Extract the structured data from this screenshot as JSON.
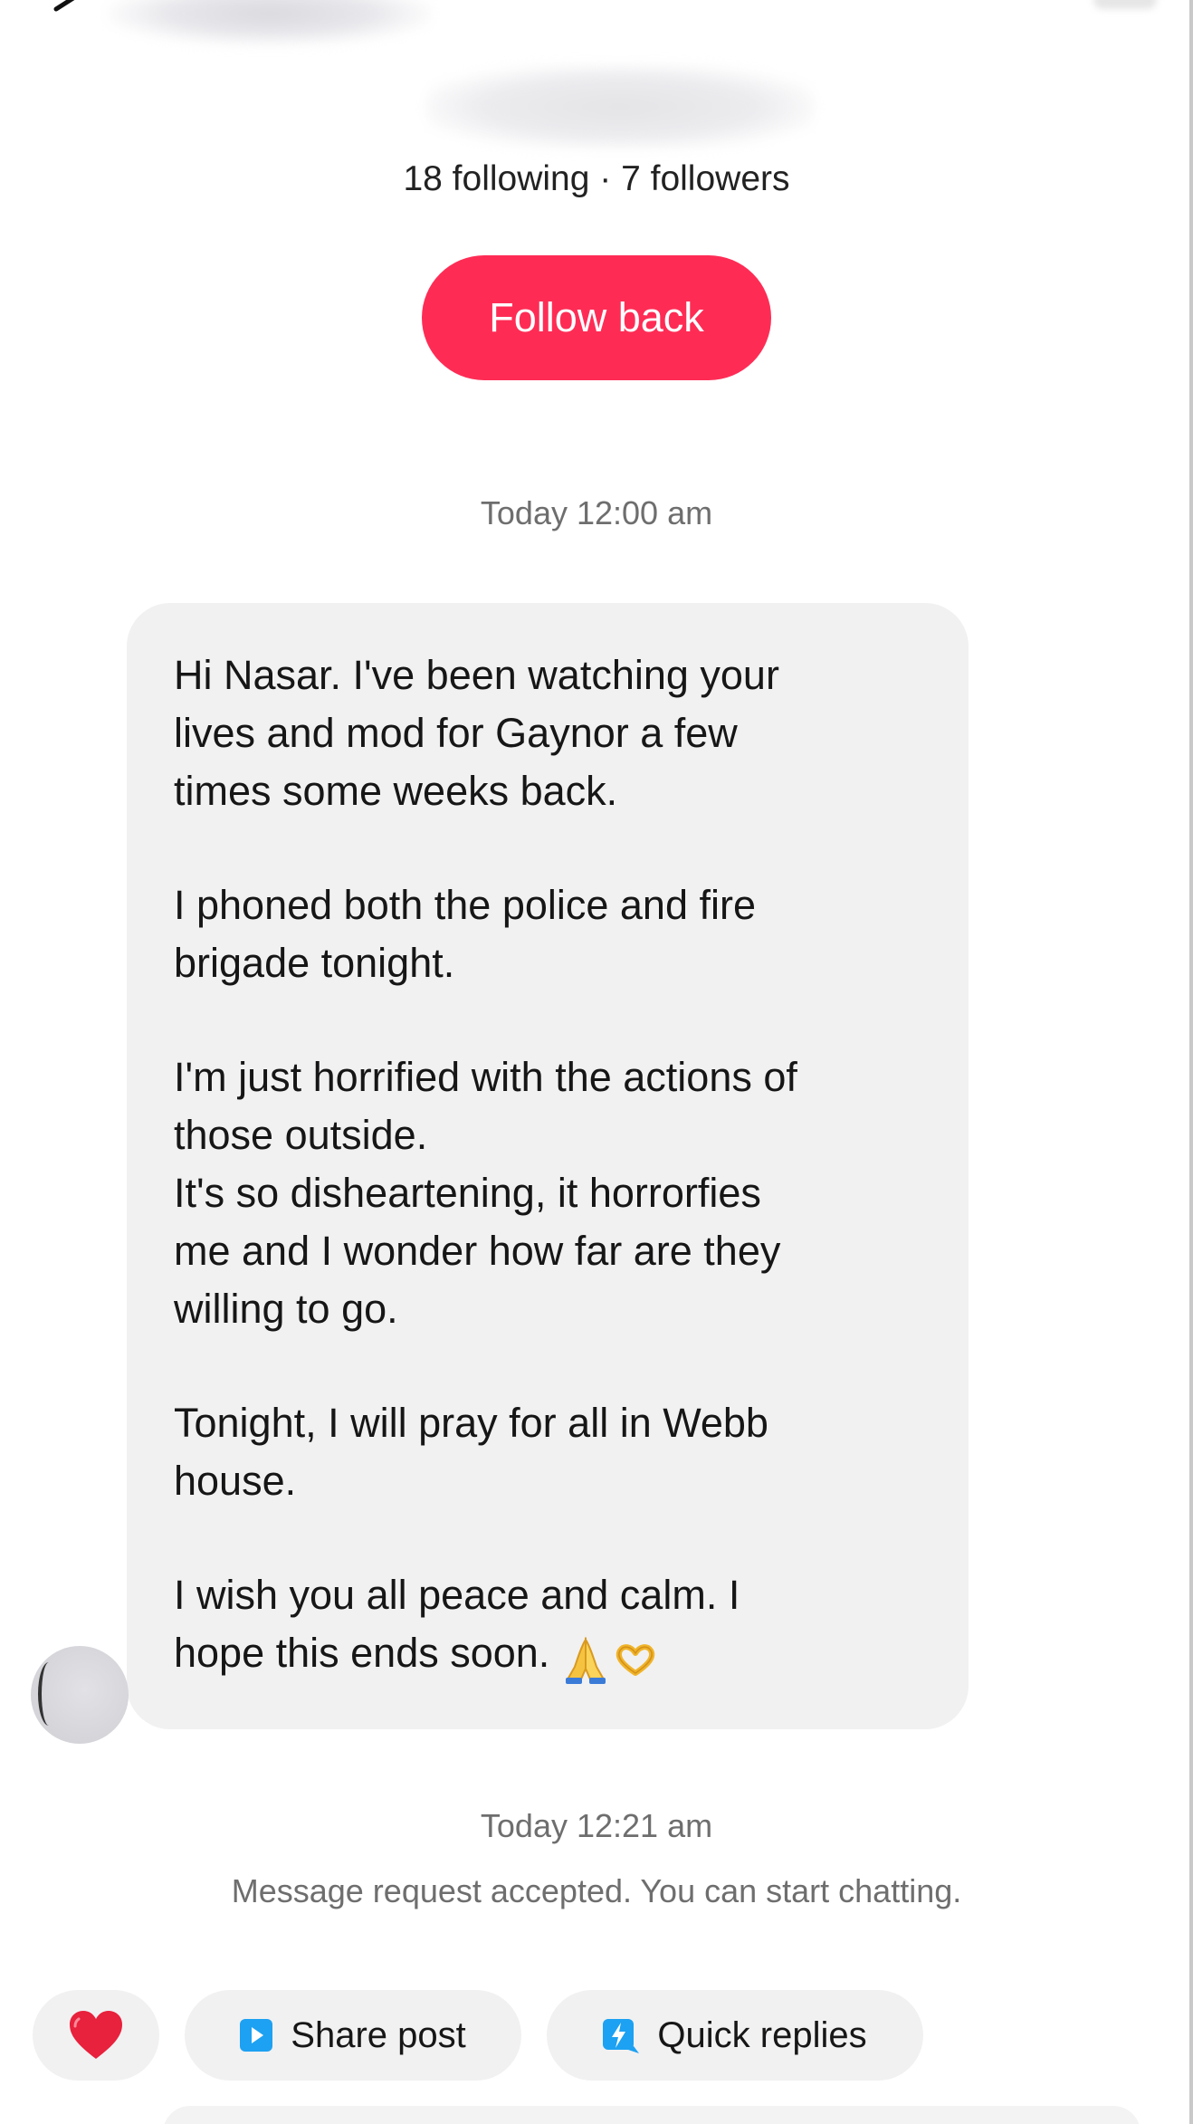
{
  "header": {
    "follow_stats": "18 following · 7 followers",
    "follow_back_label": "Follow back"
  },
  "conversation": {
    "timestamp_1": "Today 12:00 am",
    "message": {
      "paragraphs": [
        "Hi Nasar. I've been watching your\nlives and mod for Gaynor a few\ntimes some weeks back.",
        "I phoned both the police and fire\nbrigade tonight.",
        "I'm just horrified with the actions of\nthose outside.\nIt's so disheartening, it horrorfies\nme and I wonder how far are they\nwilling to go.",
        "Tonight, I will pray for all in Webb\nhouse.",
        "I wish you all peace and calm. I\nhope this ends soon."
      ],
      "emojis": [
        "folded-hands-icon",
        "heart-hands-icon"
      ]
    },
    "timestamp_2": "Today 12:21 am",
    "system_note": "Message request accepted. You can start chatting."
  },
  "actions": {
    "heart_icon": "heart-icon",
    "share_post_label": "Share post",
    "quick_replies_label": "Quick replies"
  },
  "colors": {
    "accent": "#fe2c55",
    "bubble_bg": "#f1f1f2",
    "muted_text": "#6e6e6e",
    "share_icon_bg": "#1da1f2",
    "heart": "#e8213c"
  }
}
